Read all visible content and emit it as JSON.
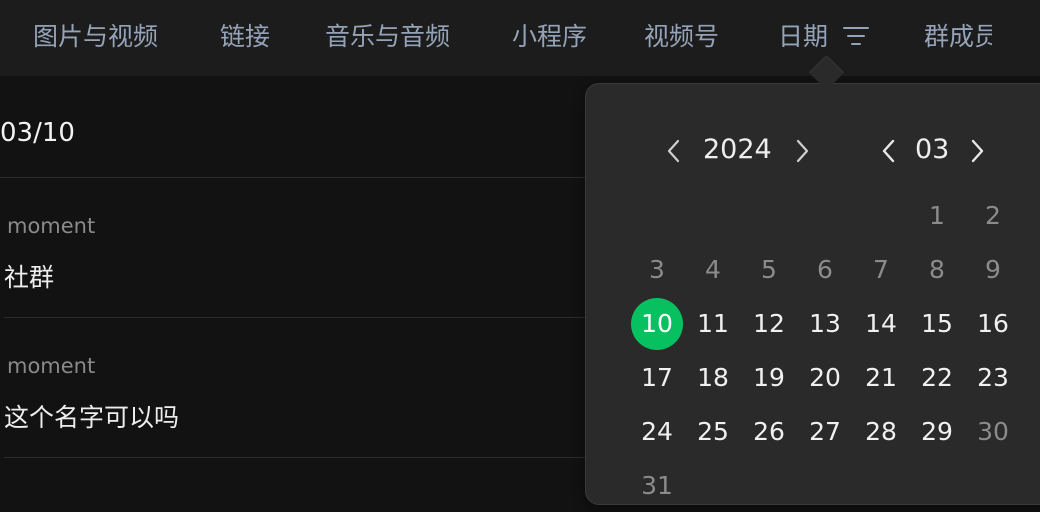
{
  "tabs": [
    {
      "label": "图片与视频"
    },
    {
      "label": "链接"
    },
    {
      "label": "音乐与音频"
    },
    {
      "label": "小程序"
    },
    {
      "label": "视频号"
    },
    {
      "label": "日期",
      "active": true,
      "icon": "filter-icon"
    },
    {
      "label": "群成员",
      "truncated": true
    }
  ],
  "date_header": "03/10",
  "messages": [
    {
      "source": "moment",
      "text": "社群"
    },
    {
      "source": "moment",
      "text": "这个名字可以吗"
    }
  ],
  "calendar": {
    "year": "2024",
    "month": "03",
    "selected_day": 10,
    "accent_color": "#07c160",
    "days": [
      {
        "d": "1",
        "dim": true
      },
      {
        "d": "2",
        "dim": true
      },
      {
        "d": "3",
        "dim": true
      },
      {
        "d": "4",
        "dim": true
      },
      {
        "d": "5",
        "dim": true
      },
      {
        "d": "6",
        "dim": true
      },
      {
        "d": "7",
        "dim": true
      },
      {
        "d": "8",
        "dim": true
      },
      {
        "d": "9",
        "dim": true
      },
      {
        "d": "10",
        "sel": true
      },
      {
        "d": "11"
      },
      {
        "d": "12"
      },
      {
        "d": "13"
      },
      {
        "d": "14"
      },
      {
        "d": "15"
      },
      {
        "d": "16"
      },
      {
        "d": "17"
      },
      {
        "d": "18"
      },
      {
        "d": "19"
      },
      {
        "d": "20"
      },
      {
        "d": "21"
      },
      {
        "d": "22"
      },
      {
        "d": "23"
      },
      {
        "d": "24"
      },
      {
        "d": "25"
      },
      {
        "d": "26"
      },
      {
        "d": "27"
      },
      {
        "d": "28"
      },
      {
        "d": "29"
      },
      {
        "d": "30",
        "dim": true
      },
      {
        "d": "31",
        "dim": true
      }
    ]
  }
}
